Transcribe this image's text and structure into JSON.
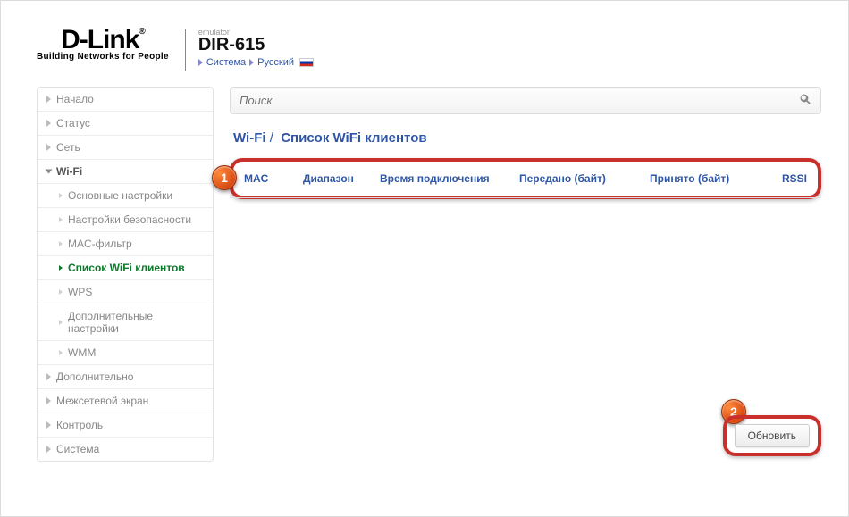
{
  "header": {
    "brand_main": "D-Link",
    "brand_tagline": "Building Networks for People",
    "model_tag": "emulator",
    "model_name": "DIR-615",
    "crumb_system": "Система",
    "crumb_language": "Русский"
  },
  "sidebar": {
    "items": {
      "start": "Начало",
      "status": "Статус",
      "network": "Сеть",
      "wifi": "Wi-Fi",
      "advanced": "Дополнительно",
      "firewall": "Межсетевой экран",
      "control": "Контроль",
      "system": "Система"
    },
    "wifi_sub": {
      "basic": "Основные настройки",
      "security": "Настройки безопасности",
      "macfilter": "MAC-фильтр",
      "clients": "Список WiFi клиентов",
      "wps": "WPS",
      "extra": "Дополнительные настройки",
      "wmm": "WMM"
    }
  },
  "search": {
    "placeholder": "Поиск"
  },
  "page": {
    "crumb_parent": "Wi-Fi",
    "title": "Список WiFi клиентов"
  },
  "table": {
    "headers": {
      "mac": "MAC",
      "band": "Диапазон",
      "conntime": "Время подключения",
      "tx": "Передано (байт)",
      "rx": "Принято (байт)",
      "rssi": "RSSI"
    },
    "rows": []
  },
  "actions": {
    "refresh": "Обновить"
  },
  "callouts": {
    "one": "1",
    "two": "2"
  }
}
